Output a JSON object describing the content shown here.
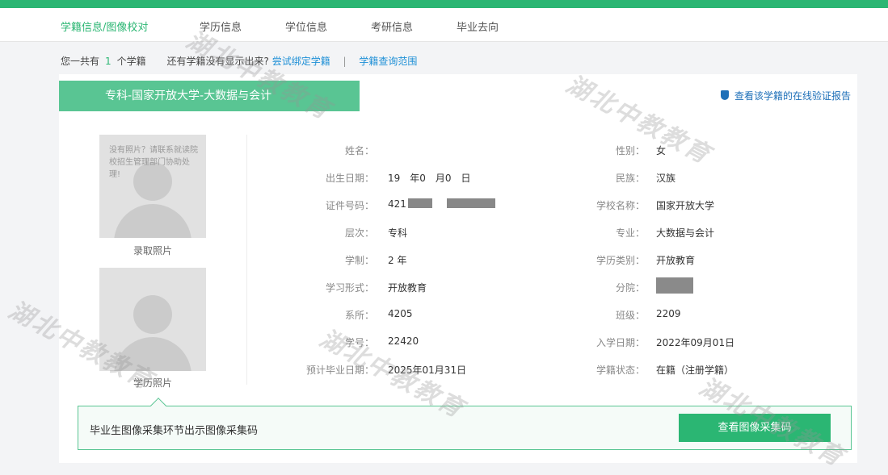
{
  "tabs": [
    {
      "label": "学籍信息/图像校对",
      "active": true
    },
    {
      "label": "学历信息",
      "active": false
    },
    {
      "label": "学位信息",
      "active": false
    },
    {
      "label": "考研信息",
      "active": false
    },
    {
      "label": "毕业去向",
      "active": false
    }
  ],
  "summary": {
    "prefix": "您一共有",
    "count": "1",
    "suffix": "个学籍",
    "question": "还有学籍没有显示出来?",
    "bind_link": "尝试绑定学籍",
    "separator": "|",
    "scope_link": "学籍查询范围"
  },
  "card": {
    "title": "专科-国家开放大学-大数据与会计",
    "verify_link": "查看该学籍的在线验证报告",
    "photo_note": "没有照片？请联系就读院校招生管理部门协助处理!",
    "photo1_caption": "录取照片",
    "photo2_caption": "学历照片"
  },
  "fields_left": [
    {
      "label": "姓名：",
      "value": "　"
    },
    {
      "label": "出生日期：",
      "value": "19　年0　月0　日"
    },
    {
      "label": "证件号码：",
      "value": "421"
    },
    {
      "label": "层次：",
      "value": "专科"
    },
    {
      "label": "学制：",
      "value": "2 年"
    },
    {
      "label": "学习形式：",
      "value": "开放教育"
    },
    {
      "label": "系所：",
      "value": "4205"
    },
    {
      "label": "学号：",
      "value": "22420"
    },
    {
      "label": "预计毕业日期：",
      "value": "2025年01月31日"
    }
  ],
  "fields_right": [
    {
      "label": "性别：",
      "value": "女"
    },
    {
      "label": "民族：",
      "value": "汉族"
    },
    {
      "label": "学校名称：",
      "value": "国家开放大学"
    },
    {
      "label": "专业：",
      "value": "大数据与会计"
    },
    {
      "label": "学历类别：",
      "value": "开放教育"
    },
    {
      "label": "分院：",
      "value": ""
    },
    {
      "label": "班级：",
      "value": "2209"
    },
    {
      "label": "入学日期：",
      "value": "2022年09月01日"
    },
    {
      "label": "学籍状态：",
      "value": "在籍（注册学籍）"
    }
  ],
  "banner": {
    "text": "毕业生图像采集环节出示图像采集码",
    "button": "查看图像采集码"
  },
  "watermark": "湖北中教教育",
  "colors": {
    "accent": "#2bb673",
    "title_bg": "#59c593",
    "link": "#1d8fd6"
  }
}
